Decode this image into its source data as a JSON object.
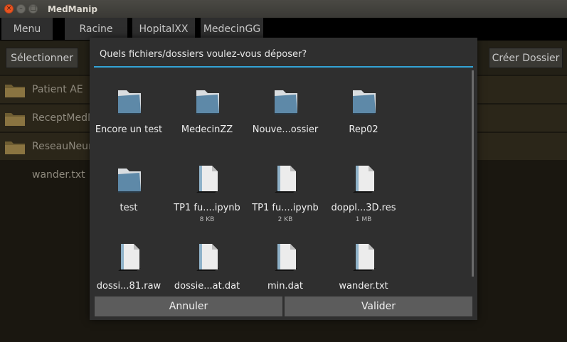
{
  "window": {
    "title": "MedManip",
    "close_glyph": "×",
    "min_glyph": "–",
    "max_glyph": "□"
  },
  "menubar": {
    "menu_label": "Menu",
    "breadcrumbs": [
      "Racine",
      "HopitalXX",
      "MedecinGG"
    ]
  },
  "toolbar": {
    "select_label": "Sélectionner",
    "create_folder_label": "Créer Dossier"
  },
  "filelist": {
    "items": [
      {
        "label": "Patient AE",
        "type": "folder"
      },
      {
        "label": "ReceptMedN",
        "type": "folder"
      },
      {
        "label": "ReseauNeur",
        "type": "folder"
      },
      {
        "label": "wander.txt",
        "type": "file"
      }
    ]
  },
  "dialog": {
    "title": "Quels fichiers/dossiers voulez-vous déposer?",
    "items": [
      {
        "name": "Encore un test",
        "size": "",
        "type": "folder"
      },
      {
        "name": "MedecinZZ",
        "size": "",
        "type": "folder"
      },
      {
        "name": "Nouve...ossier",
        "size": "",
        "type": "folder"
      },
      {
        "name": "Rep02",
        "size": "",
        "type": "folder"
      },
      {
        "name": "test",
        "size": "",
        "type": "folder"
      },
      {
        "name": "TP1 fu....ipynb",
        "size": "8 KB",
        "type": "file"
      },
      {
        "name": "TP1 fu....ipynb",
        "size": "2 KB",
        "type": "file"
      },
      {
        "name": "doppl...3D.res",
        "size": "1 MB",
        "type": "file"
      },
      {
        "name": "dossi...81.raw",
        "size": "",
        "type": "file"
      },
      {
        "name": "dossie...at.dat",
        "size": "",
        "type": "file"
      },
      {
        "name": "min.dat",
        "size": "",
        "type": "file"
      },
      {
        "name": "wander.txt",
        "size": "",
        "type": "file"
      }
    ],
    "cancel_label": "Annuler",
    "confirm_label": "Valider"
  },
  "colors": {
    "accent": "#33a3d6",
    "folder": "#7a6a3c"
  }
}
